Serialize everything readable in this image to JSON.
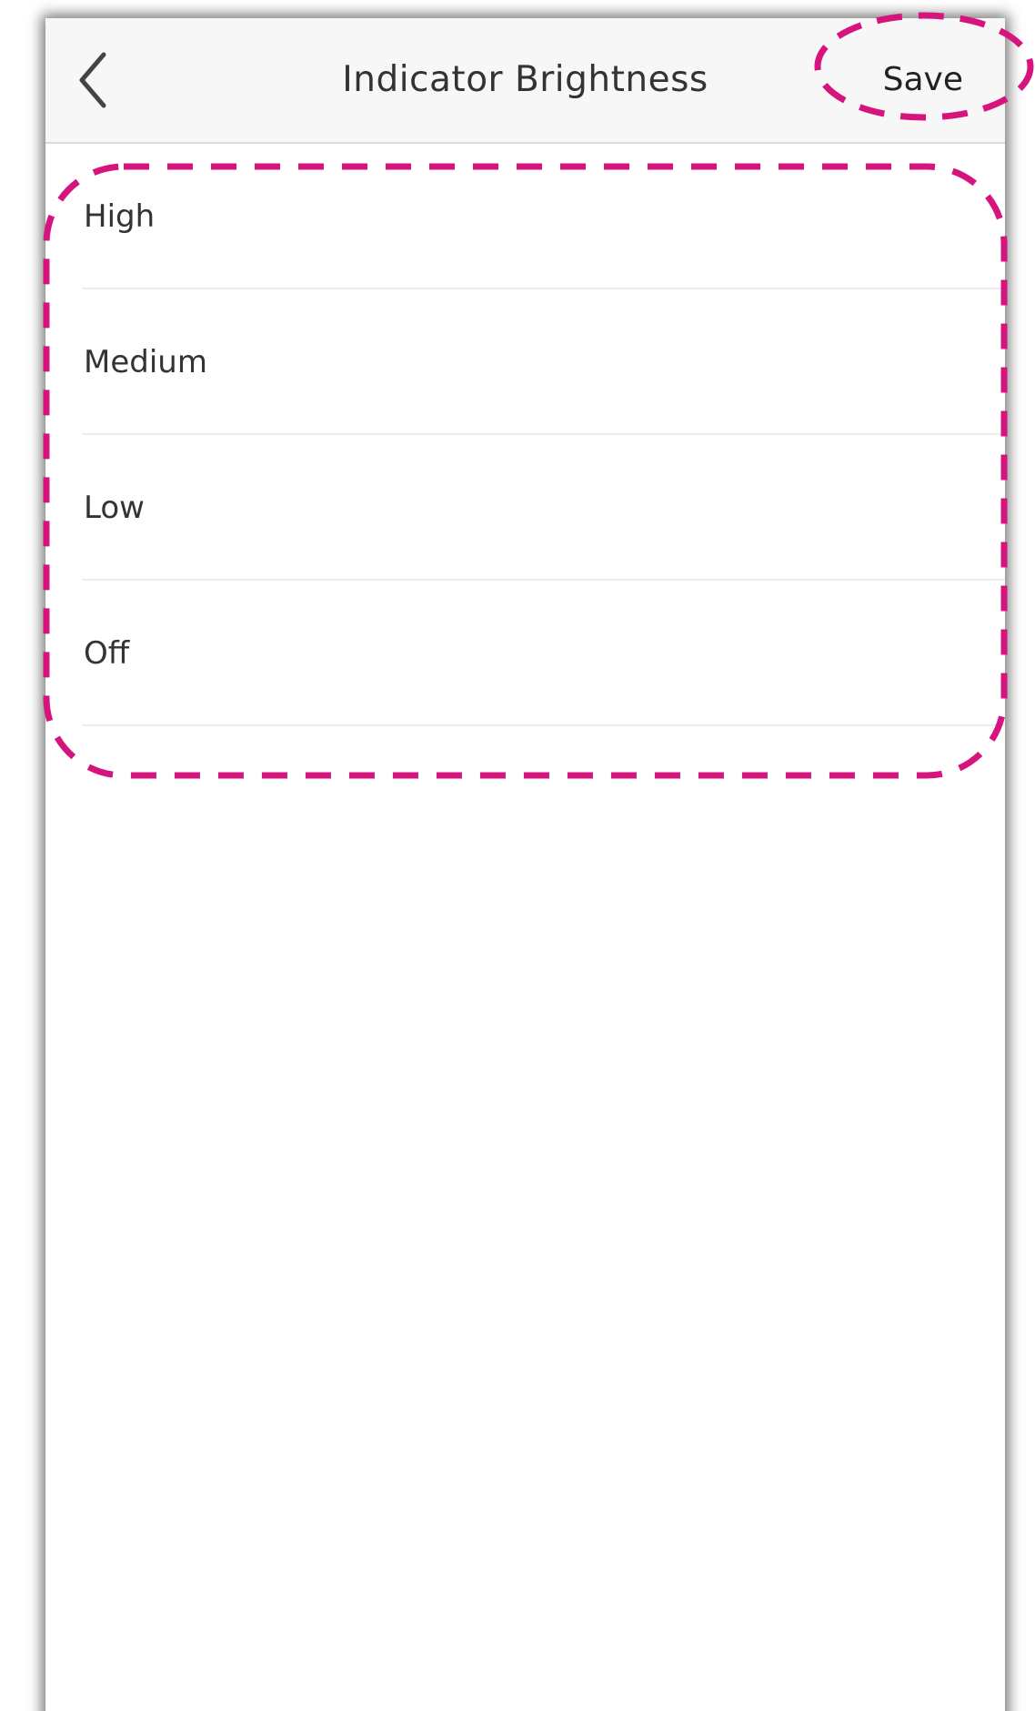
{
  "header": {
    "title": "Indicator Brightness",
    "save_label": "Save",
    "back_icon": "chevron-left-icon"
  },
  "options": [
    {
      "label": "High"
    },
    {
      "label": "Medium"
    },
    {
      "label": "Low"
    },
    {
      "label": "Off"
    }
  ],
  "colors": {
    "annotation": "#d6147e",
    "nav_background": "#f7f7f7",
    "text": "#333333",
    "divider": "#ececec"
  }
}
